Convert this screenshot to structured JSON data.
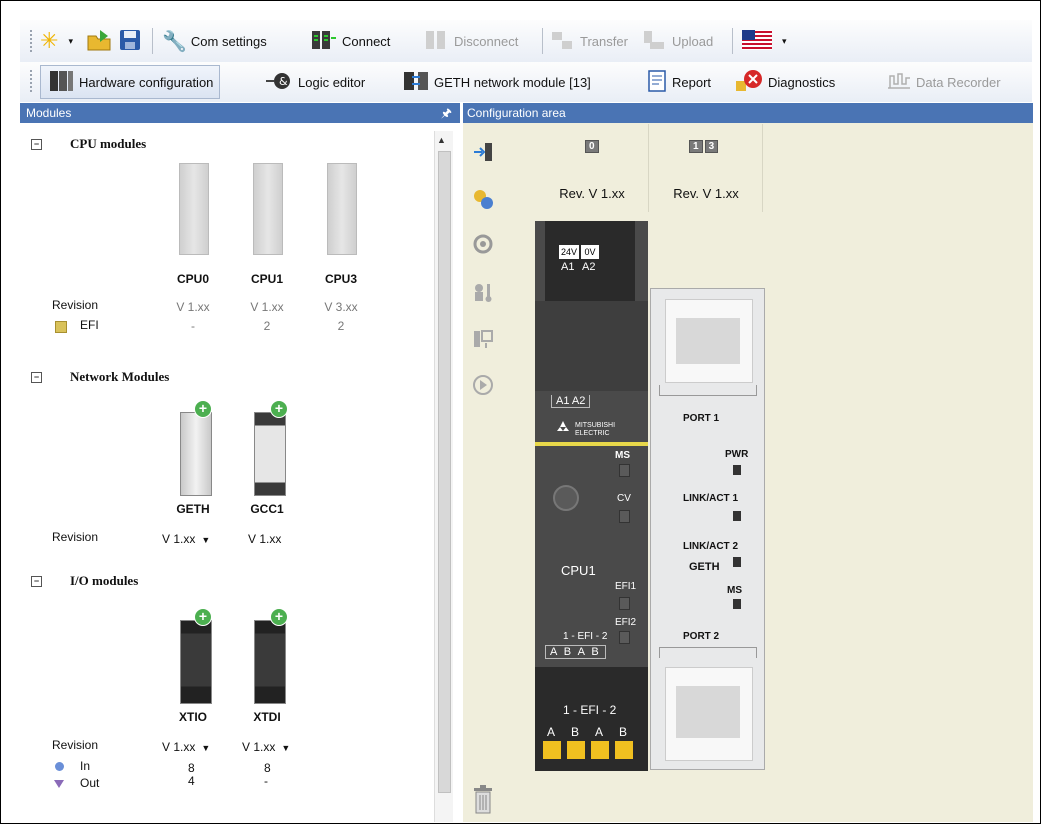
{
  "toolbar1": {
    "com_settings": "Com settings",
    "connect": "Connect",
    "disconnect": "Disconnect",
    "transfer": "Transfer",
    "upload": "Upload"
  },
  "toolbar2": {
    "hardware_configuration": "Hardware configuration",
    "logic_editor": "Logic editor",
    "geth_network_module": "GETH network module [13]",
    "report": "Report",
    "diagnostics": "Diagnostics",
    "data_recorder": "Data Recorder"
  },
  "modules_panel": {
    "title": "Modules",
    "pin_icon": "pin-icon",
    "cpu_section": {
      "title": "CPU modules",
      "modules": [
        {
          "name": "CPU0",
          "revision": "V 1.xx",
          "efi": "-"
        },
        {
          "name": "CPU1",
          "revision": "V 1.xx",
          "efi": "2"
        },
        {
          "name": "CPU3",
          "revision": "V 3.xx",
          "efi": "2"
        }
      ],
      "revision_label": "Revision",
      "efi_label": "EFI",
      "efi_color": "#d9c25a"
    },
    "network_section": {
      "title": "Network Modules",
      "modules": [
        {
          "name": "GETH",
          "revision": "V 1.xx"
        },
        {
          "name": "GCC1",
          "revision": "V 1.xx"
        }
      ],
      "revision_label": "Revision"
    },
    "io_section": {
      "title": "I/O modules",
      "modules": [
        {
          "name": "XTIO",
          "revision": "V 1.xx",
          "in": "8",
          "out": "4"
        },
        {
          "name": "XTDI",
          "revision": "V 1.xx",
          "in": "8",
          "out": "-"
        }
      ],
      "revision_label": "Revision",
      "in_label": "In",
      "out_label": "Out",
      "in_color": "#6a8fd8",
      "out_color": "#8a6ab8"
    }
  },
  "config_area": {
    "title": "Configuration area",
    "slots": [
      {
        "badges": [
          "0"
        ],
        "revision": "Rev. V 1.xx"
      },
      {
        "badges": [
          "1",
          "3"
        ],
        "revision": "Rev. V 1.xx"
      }
    ],
    "cpu_module": {
      "terminal_top": [
        "24V",
        "0V"
      ],
      "terminal_bottom": [
        "A1",
        "A2"
      ],
      "terminal_label": "A1  A2",
      "brand": "MITSUBISHI ELECTRIC",
      "ms": "MS",
      "cv": "CV",
      "name": "CPU1",
      "efi1": "EFI1",
      "efi2": "EFI2",
      "efi_label": "1 - EFI - 2",
      "ab_labels": "A  B  A  B",
      "bottom_efi_label": "1 - EFI - 2",
      "bottom_ab": [
        "A",
        "B",
        "A",
        "B"
      ]
    },
    "geth_module": {
      "port1": "PORT 1",
      "pwr": "PWR",
      "link_act1": "LINK/ACT 1",
      "link_act2": "LINK/ACT 2",
      "name": "GETH",
      "ms": "MS",
      "port2": "PORT 2"
    }
  }
}
